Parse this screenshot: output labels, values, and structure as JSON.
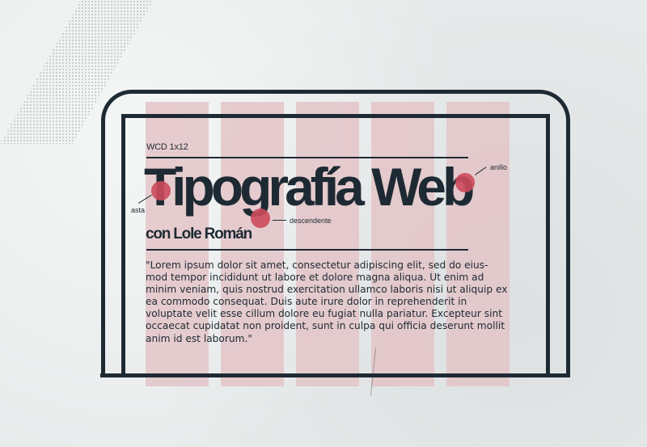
{
  "poster": {
    "kicker": "WCD 1x12",
    "title": "Tipografía Web",
    "subtitle": "con Lole Román",
    "body": "\"Lorem ipsum dolor sit amet, consectetur adipiscing elit, sed do eius-mod tempor incididunt ut labore et dolore magna aliqua. Ut enim ad minim veniam, quis nostrud exercitation ullamco laboris nisi ut aliquip ex ea commodo consequat. Duis aute irure dolor in reprehenderit in voluptate velit esse cillum dolore eu fugiat nulla pariatur. Excepteur sint occaecat cupidatat non proident, sunt in culpa qui officia deserunt mollit anim id est laborum.\""
  },
  "annotations": {
    "stem": "asta",
    "descender": "descendente",
    "ring": "anillo"
  },
  "colors": {
    "ink": "#1e2a33",
    "accent": "#cc4a5c",
    "grid_column": "#e3c4c8",
    "background": "#e8ebeb"
  }
}
